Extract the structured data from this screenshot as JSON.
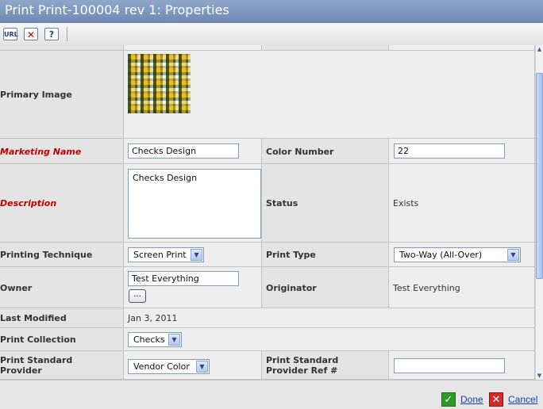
{
  "window": {
    "title": "Print Print-100004 rev 1: Properties"
  },
  "toolbar": {
    "buttons": [
      {
        "name": "url-icon",
        "glyph": "URL"
      },
      {
        "name": "clear-fields-icon",
        "glyph": "✕"
      },
      {
        "name": "help-icon",
        "glyph": "?"
      }
    ]
  },
  "form": {
    "primary_image": {
      "label": "Primary Image"
    },
    "marketing_name": {
      "label": "Marketing Name",
      "value": "Checks Design"
    },
    "color_number": {
      "label": "Color Number",
      "value": "22"
    },
    "description": {
      "label": "Description",
      "value": "Checks Design"
    },
    "status": {
      "label": "Status",
      "value": "Exists"
    },
    "printing_technique": {
      "label": "Printing Technique",
      "value": "Screen Print"
    },
    "print_type": {
      "label": "Print Type",
      "value": "Two-Way (All-Over)"
    },
    "owner": {
      "label": "Owner",
      "value": "Test Everything",
      "browse_label": "..."
    },
    "originator": {
      "label": "Originator",
      "value": "Test Everything"
    },
    "last_modified": {
      "label": "Last Modified",
      "value": "Jan 3, 2011"
    },
    "print_collection": {
      "label": "Print Collection",
      "value": "Checks"
    },
    "print_standard_provider": {
      "label": "Print Standard Provider",
      "value": "Vendor Color"
    },
    "print_standard_provider_ref": {
      "label": "Print Standard Provider Ref #",
      "value": ""
    }
  },
  "footer": {
    "done_label": "Done",
    "cancel_label": "Cancel"
  },
  "colors": {
    "title_bar": "#7a93bb",
    "required_label": "#c00000",
    "link": "#1a3fa8"
  }
}
